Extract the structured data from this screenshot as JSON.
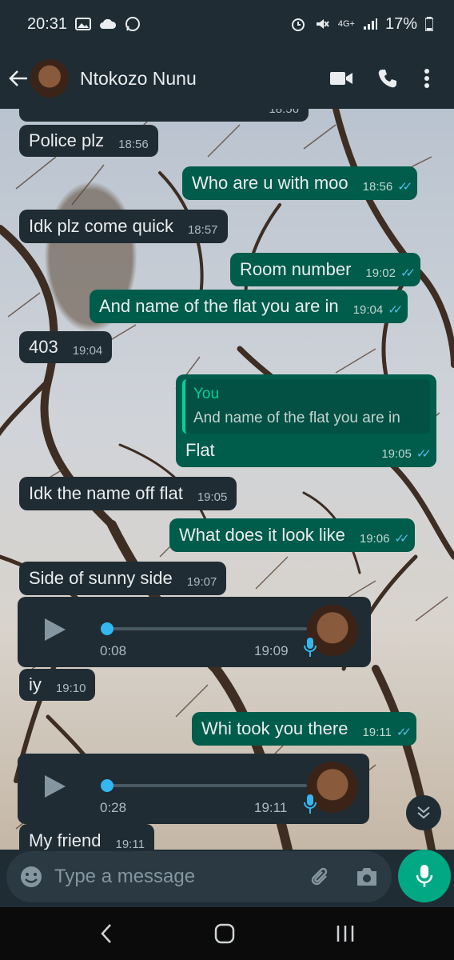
{
  "status_bar": {
    "time": "20:31",
    "network": "4G+",
    "battery": "17%"
  },
  "contact": {
    "name": "Ntokozo Nunu"
  },
  "messages": [
    {
      "dir": "in",
      "text": "",
      "time": "18:56"
    },
    {
      "dir": "in",
      "text": "Police plz",
      "time": "18:56"
    },
    {
      "dir": "out",
      "text": "Who are u with moo",
      "time": "18:56"
    },
    {
      "dir": "in",
      "text": "Idk plz come quick",
      "time": "18:57"
    },
    {
      "dir": "out",
      "text": "Room number",
      "time": "19:02"
    },
    {
      "dir": "out",
      "text": "And name of the flat you are in",
      "time": "19:04"
    },
    {
      "dir": "in",
      "text": "403",
      "time": "19:04"
    },
    {
      "dir": "out",
      "reply_author": "You",
      "reply_text": "And name of the flat you are in",
      "text": "Flat",
      "time": "19:05"
    },
    {
      "dir": "in",
      "text": "Idk the name off flat",
      "time": "19:05"
    },
    {
      "dir": "out",
      "text": "What does it look like",
      "time": "19:06"
    },
    {
      "dir": "in",
      "text": "Side of sunny side",
      "time": "19:07"
    },
    {
      "dir": "in",
      "type": "voice",
      "duration": "0:08",
      "time": "19:09"
    },
    {
      "dir": "in",
      "text": "iy",
      "time": "19:10"
    },
    {
      "dir": "out",
      "text": "Whi took you there",
      "time": "19:11"
    },
    {
      "dir": "in",
      "type": "voice",
      "duration": "0:28",
      "time": "19:11"
    },
    {
      "dir": "in",
      "text": "My friend",
      "time": "19:11"
    }
  ],
  "composer": {
    "placeholder": "Type a message"
  },
  "colors": {
    "incoming": "#202c33",
    "outgoing": "#005c4b",
    "accent": "#00a884",
    "read_ticks": "#53bdeb"
  }
}
